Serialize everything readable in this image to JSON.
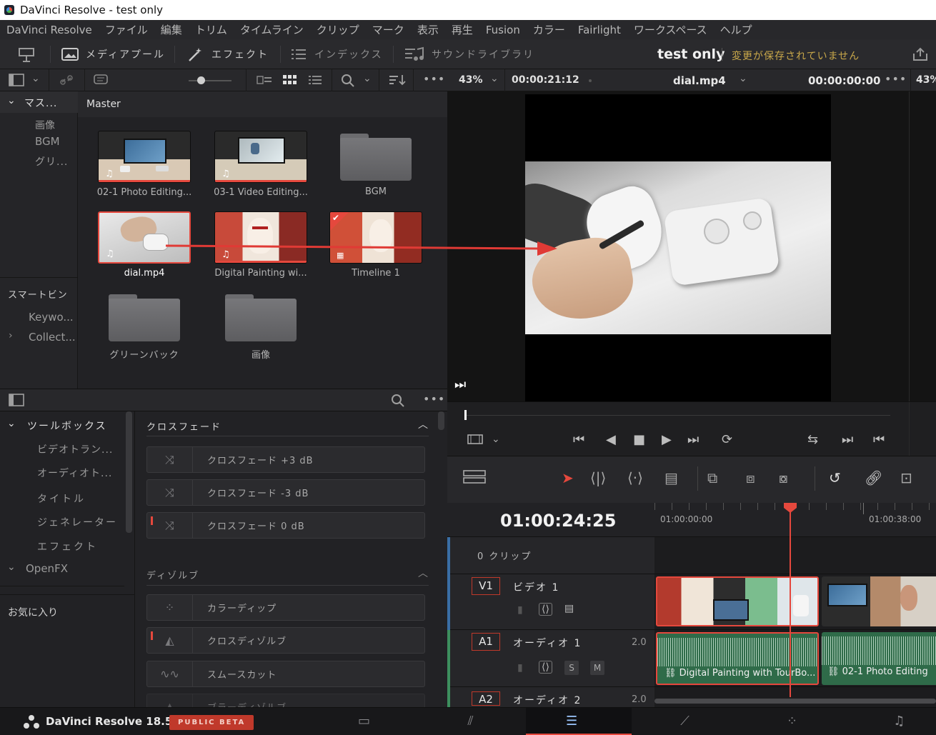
{
  "window": {
    "title": "DaVinci Resolve - test only"
  },
  "menu": [
    "DaVinci Resolve",
    "ファイル",
    "編集",
    "トリム",
    "タイムライン",
    "クリップ",
    "マーク",
    "表示",
    "再生",
    "Fusion",
    "カラー",
    "Fairlight",
    "ワークスペース",
    "ヘルプ"
  ],
  "toolbar": {
    "media_pool": "メディアプール",
    "effects": "エフェクト",
    "index": "インデックス",
    "sound_library": "サウンドライブラリ",
    "project_title": "test only",
    "unsaved": "変更が保存されていません"
  },
  "viewer_bar": {
    "zoom": "43%",
    "duration": "00:00:21:12",
    "clip_name": "dial.mp4",
    "timecode": "00:00:00:00",
    "zoom2": "43%"
  },
  "bins": {
    "root": "マス...",
    "children": [
      "画像",
      "BGM",
      "グリ..."
    ],
    "smart_bins_label": "スマートビン",
    "smart_children": [
      "Keywo...",
      "Collect..."
    ]
  },
  "media_pool": {
    "header": "Master",
    "items": [
      {
        "name": "02-1 Photo Editing..."
      },
      {
        "name": "03-1 Video Editing..."
      },
      {
        "name": "BGM"
      },
      {
        "name": "dial.mp4"
      },
      {
        "name": "Digital Painting wi..."
      },
      {
        "name": "Timeline 1"
      },
      {
        "name": "グリーンバック"
      },
      {
        "name": "画像"
      }
    ]
  },
  "toolbox": {
    "root": "ツールボックス",
    "children": [
      "ビデオトラン...",
      "オーディオト...",
      "タイトル",
      "ジェネレーター",
      "エフェクト"
    ],
    "openfx": "OpenFX",
    "favorites": "お気に入り"
  },
  "fx": {
    "crossfade_header": "クロスフェード",
    "crossfade_items": [
      "クロスフェード +3 dB",
      "クロスフェード -3 dB",
      "クロスフェード 0 dB"
    ],
    "dissolve_header": "ディゾルブ",
    "dissolve_items": [
      "カラーディップ",
      "クロスディゾルブ",
      "スムースカット",
      "ブラーディゾルブ"
    ]
  },
  "timeline": {
    "timecode": "01:00:24:25",
    "ruler": [
      "01:00:00:00",
      "01:00:38:00"
    ],
    "clips_label": "0 クリップ",
    "tracks": [
      {
        "tag": "V1",
        "name": "ビデオ 1"
      },
      {
        "tag": "A1",
        "name": "オーディオ 1",
        "level": "2.0"
      },
      {
        "tag": "A2",
        "name": "オーディオ 2",
        "level": "2.0"
      }
    ],
    "audio_clips": [
      "Digital Painting with TourBo...",
      "02-1 Photo Editing"
    ],
    "solo": "S",
    "mute": "M"
  },
  "bottom": {
    "app_name": "DaVinci Resolve 18.5",
    "beta": "PUBLIC BETA"
  },
  "colors": {
    "accent_red": "#e5483d",
    "audio_green": "#3d8f5e"
  }
}
